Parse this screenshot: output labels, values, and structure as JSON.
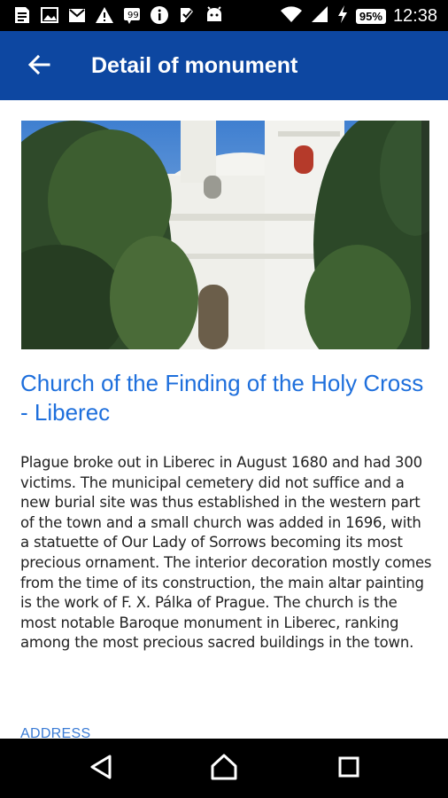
{
  "status_bar": {
    "time": "12:38",
    "battery": "95%",
    "icons": [
      "notes-icon",
      "image-icon",
      "gmail-icon",
      "warning-icon",
      "quote-icon",
      "info-icon",
      "task-icon",
      "android-icon",
      "wifi-icon",
      "signal-icon",
      "charging-icon"
    ]
  },
  "app_bar": {
    "title": "Detail of monument",
    "back_icon": "arrow-back-icon"
  },
  "monument": {
    "title": "Church of the Finding of the Holy Cross - Liberec",
    "description": "Plague broke out in Liberec in August 1680 and had 300 victims. The municipal cemetery did not suffice and a new burial site was thus established in the western part of the town and a small church was added in 1696, with a statuette of Our Lady of Sorrows becoming its most precious ornament. The interior decoration mostly comes from the time of its construction, the main altar painting is the work of F. X. Pálka of Prague. The church is the most notable Baroque monument in Liberec, ranking among the most precious sacred buildings in the town.",
    "address_label": "ADDRESS"
  },
  "nav_bar": {
    "icons": [
      "back-triangle-icon",
      "home-icon",
      "recents-icon"
    ]
  },
  "colors": {
    "app_bar": "#0d47a1",
    "title_link": "#1e6fdc",
    "status_bar": "#000000"
  }
}
